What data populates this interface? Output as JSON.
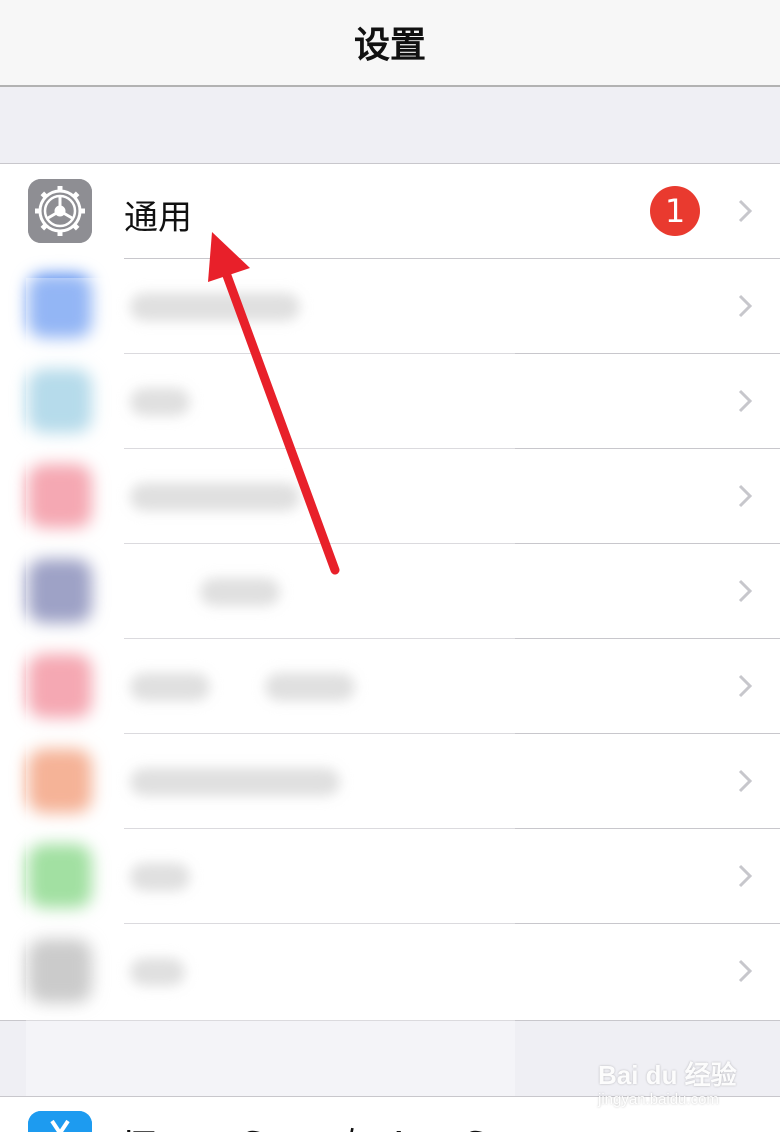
{
  "nav": {
    "title": "设置"
  },
  "settings": {
    "general": {
      "label": "通用",
      "badge": "1",
      "icon": "gear-icon"
    },
    "blurred_rows": [
      {
        "icon_color": "#5a8ff0"
      },
      {
        "icon_color": "#8fc8e0"
      },
      {
        "icon_color": "#f07a8a"
      },
      {
        "icon_color": "#6a70a8"
      },
      {
        "icon_color": "#f07a8a"
      },
      {
        "icon_color": "#f08a60"
      },
      {
        "icon_color": "#70d070"
      },
      {
        "icon_color": "#b0b0b0"
      }
    ]
  },
  "store": {
    "label": "iTunes Store 与 App Store",
    "icon": "app-store-icon"
  },
  "annotation": {
    "arrow_color": "#e8202a"
  },
  "watermark": {
    "logo": "Bai du 经验",
    "url": "jingyan.baidu.com"
  }
}
